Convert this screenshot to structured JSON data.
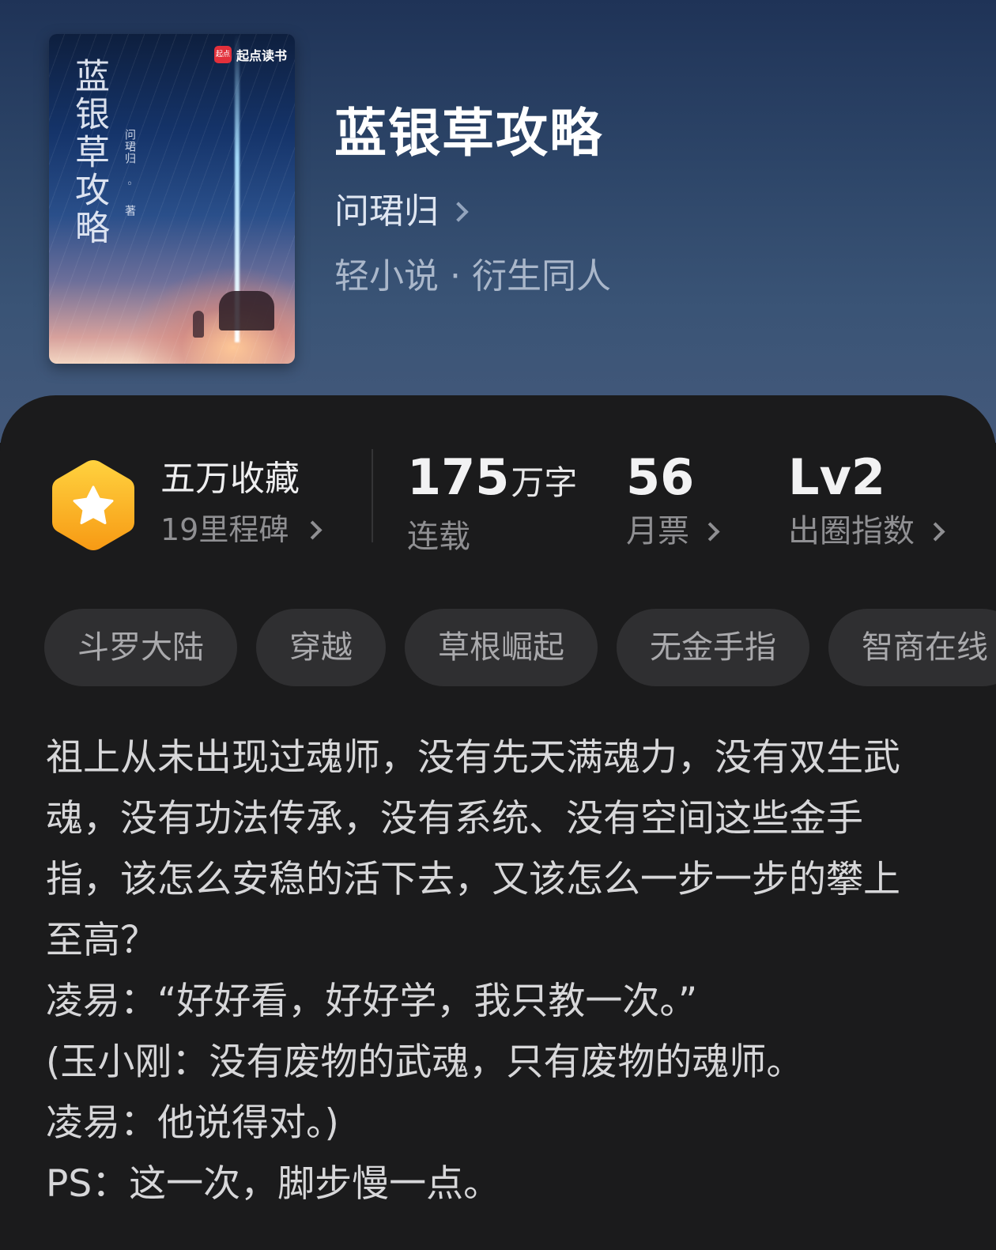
{
  "book": {
    "title": "蓝银草攻略",
    "author": "问珺归",
    "category_main": "轻小说",
    "category_separator": "·",
    "category_sub": "衍生同人"
  },
  "cover": {
    "title": "蓝银草攻略",
    "author_line": "问珺归 ◦ 著",
    "brand_logo_text": "起点",
    "brand_name": "起点读书"
  },
  "stats": {
    "favorites_main": "五万收藏",
    "favorites_sub": "19里程碑",
    "word_count_number": "175",
    "word_count_unit": "万字",
    "word_count_label": "连载",
    "monthly_votes_value": "56",
    "monthly_votes_label": "月票",
    "influence_value": "Lv2",
    "influence_label": "出圈指数"
  },
  "tags": [
    "斗罗大陆",
    "穿越",
    "草根崛起",
    "无金手指",
    "智商在线"
  ],
  "description": [
    "祖上从未出现过魂师，没有先天满魂力，没有双生武魂，没有功法传承，没有系统、没有空间这些金手指，该怎么安稳的活下去，又该怎么一步一步的攀上至高？",
    "凌易：“好好看，好好学，我只教一次。”",
    "(玉小刚：没有废物的武魂，只有废物的魂师。",
    "凌易：他说得对。)",
    "PS：这一次，脚步慢一点。"
  ],
  "colors": {
    "hero_gradient_top": "#1f3357",
    "hero_gradient_bottom": "#44597b",
    "panel_bg": "#1b1b1c",
    "badge_gold": "#f7b21c",
    "tag_bg": "#2f2f31"
  },
  "icons": {
    "favorites_badge": "hexagon-star-icon",
    "chevron": "chevron-right-icon"
  }
}
